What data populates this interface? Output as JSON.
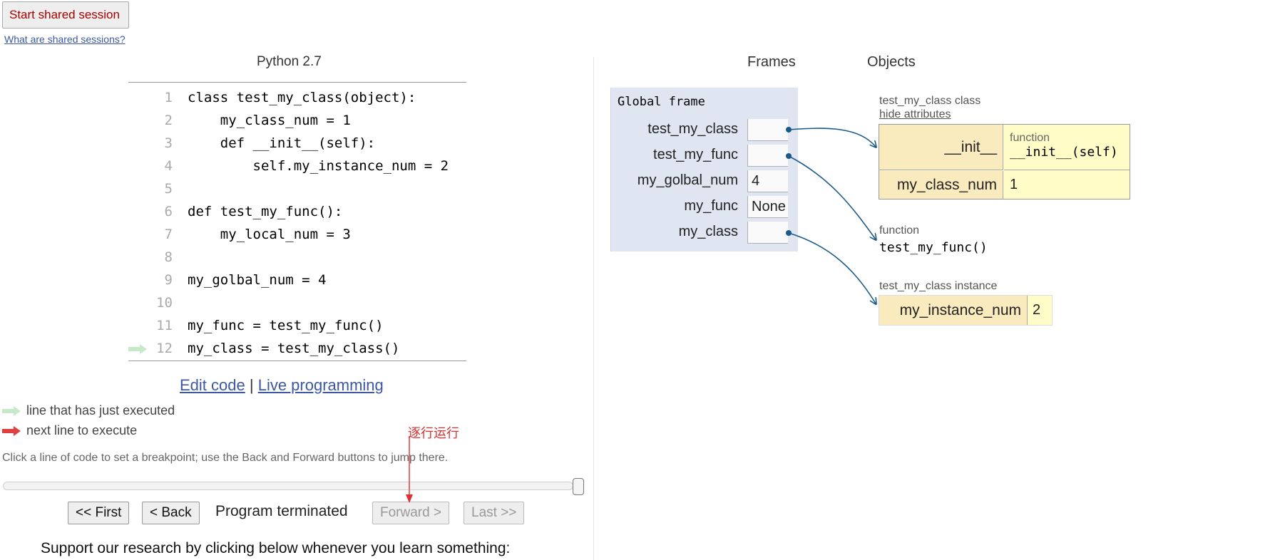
{
  "top": {
    "share_button": "Start shared session",
    "share_link": "What are shared sessions?"
  },
  "code_panel": {
    "language": "Python 2.7",
    "current_line": 12,
    "lines": [
      {
        "num": "1",
        "code": "class test_my_class(object):"
      },
      {
        "num": "2",
        "code": "    my_class_num = 1"
      },
      {
        "num": "3",
        "code": "    def __init__(self):"
      },
      {
        "num": "4",
        "code": "        self.my_instance_num = 2"
      },
      {
        "num": "5",
        "code": ""
      },
      {
        "num": "6",
        "code": "def test_my_func():"
      },
      {
        "num": "7",
        "code": "    my_local_num = 3"
      },
      {
        "num": "8",
        "code": ""
      },
      {
        "num": "9",
        "code": "my_golbal_num = 4"
      },
      {
        "num": "10",
        "code": ""
      },
      {
        "num": "11",
        "code": "my_func = test_my_func()"
      },
      {
        "num": "12",
        "code": "my_class = test_my_class()"
      }
    ],
    "edit_link": "Edit code",
    "separator": "|",
    "live_link": "Live programming"
  },
  "legend": {
    "executed": "line that has just executed",
    "next": "next line to execute",
    "executed_color": "#c6e9c9",
    "next_color": "#e04040"
  },
  "annotation": {
    "note": "逐行运行",
    "color": "#e03030"
  },
  "hint": "Click a line of code to set a breakpoint; use the Back and Forward buttons to jump there.",
  "navigation": {
    "slider_fraction": 1.0,
    "first": "<< First",
    "back": "< Back",
    "status": "Program terminated",
    "forward": "Forward >",
    "last": "Last >>"
  },
  "support": "Support our research by clicking below whenever you learn something:",
  "visualizer": {
    "frames_header": "Frames",
    "objects_header": "Objects",
    "global_frame": {
      "title": "Global frame",
      "vars": [
        {
          "name": "test_my_class",
          "value": "",
          "pointer": true
        },
        {
          "name": "test_my_func",
          "value": "",
          "pointer": true
        },
        {
          "name": "my_golbal_num",
          "value": "4",
          "pointer": false
        },
        {
          "name": "my_func",
          "value": "None",
          "pointer": false
        },
        {
          "name": "my_class",
          "value": "",
          "pointer": true
        }
      ]
    },
    "objects": {
      "class_obj": {
        "label": "test_my_class class",
        "toggle": "hide attributes",
        "attrs": [
          {
            "key": "__init__",
            "type": "function",
            "value": "__init__(self)"
          },
          {
            "key": "my_class_num",
            "value": "1"
          }
        ]
      },
      "func_obj": {
        "type": "function",
        "value": "test_my_func()"
      },
      "instance_obj": {
        "label": "test_my_class instance",
        "attrs": [
          {
            "key": "my_instance_num",
            "value": "2"
          }
        ]
      }
    },
    "arrow_color": "#1a5a8a"
  }
}
